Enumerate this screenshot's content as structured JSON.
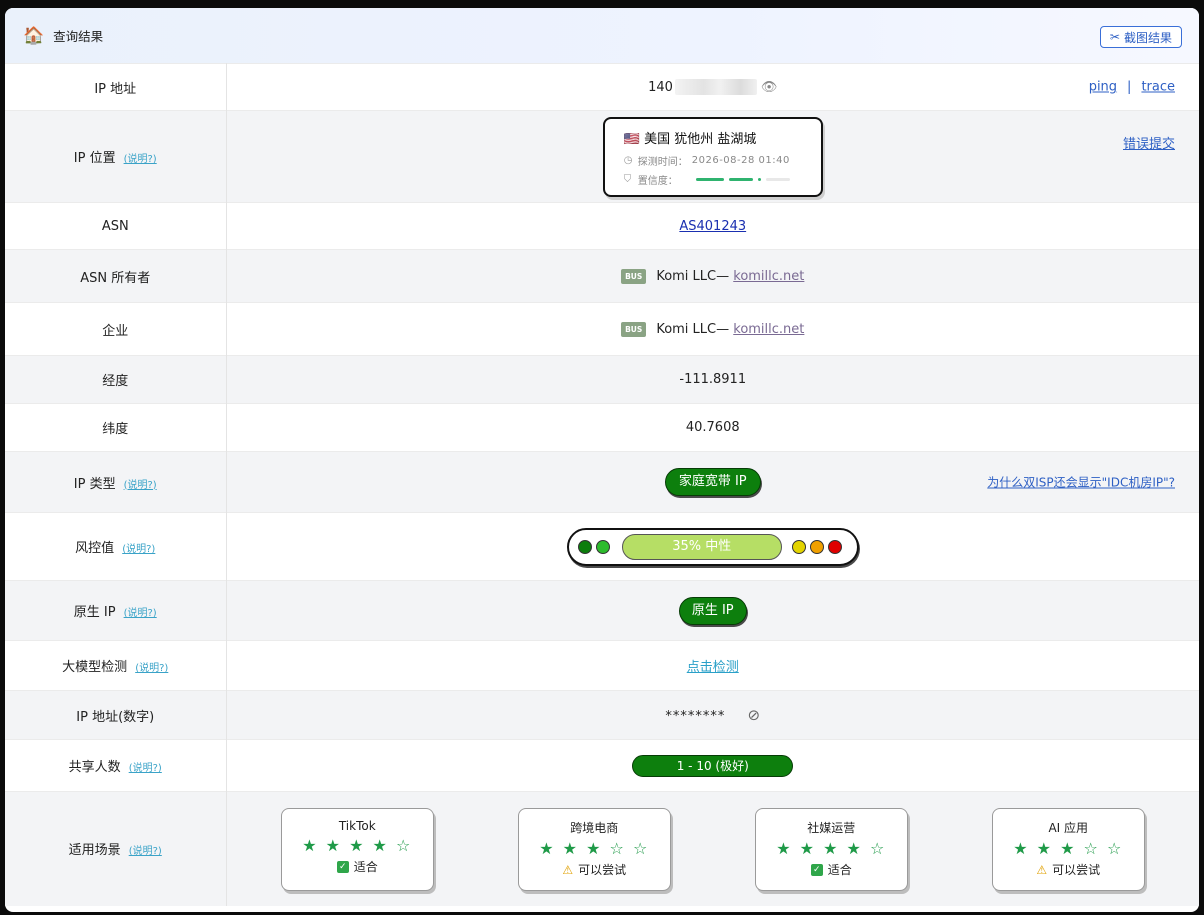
{
  "header": {
    "title": "查询结果",
    "screenshot_button": "截图结果"
  },
  "rows": {
    "ip": {
      "label": "IP 地址",
      "value_prefix": "140",
      "ping": "ping",
      "sep": "|",
      "trace": "trace"
    },
    "location": {
      "label": "IP 位置",
      "help": "(说明?)",
      "flag": "🇺🇸",
      "place": "美国 犹他州 盐湖城",
      "time_label": "探测时间：",
      "time_value": "2026-08-28 01:40",
      "confidence_label": "置信度：",
      "report": "错误提交"
    },
    "asn": {
      "label": "ASN",
      "value": "AS401243"
    },
    "asn_owner": {
      "label": "ASN 所有者",
      "badge": "BUS",
      "name": "Komi LLC— ",
      "domain": "komillc.net"
    },
    "company": {
      "label": "企业",
      "badge": "BUS",
      "name": "Komi LLC— ",
      "domain": "komillc.net"
    },
    "longitude": {
      "label": "经度",
      "value": "-111.8911"
    },
    "latitude": {
      "label": "纬度",
      "value": "40.7608"
    },
    "ip_type": {
      "label": "IP 类型",
      "help": "(说明?)",
      "value": "家庭宽带 IP",
      "why": "为什么双ISP还会显示\"IDC机房IP\"?"
    },
    "risk": {
      "label": "风控值",
      "help": "(说明?)",
      "value": "35%   中性",
      "percent": 35
    },
    "native": {
      "label": "原生 IP",
      "help": "(说明?)",
      "value": "原生 IP"
    },
    "llm": {
      "label": "大模型检测",
      "help": "(说明?)",
      "value": "点击检测"
    },
    "ip_number": {
      "label": "IP 地址(数字)",
      "value": "********"
    },
    "shared": {
      "label": "共享人数",
      "help": "(说明?)",
      "value": "1 - 10 (极好)"
    },
    "scenes": {
      "label": "适用场景",
      "help": "(说明?)",
      "items": [
        {
          "name": "TikTok",
          "stars": "★ ★ ★ ★ ☆",
          "verdict": "适合",
          "kind": "ok"
        },
        {
          "name": "跨境电商",
          "stars": "★ ★ ★ ☆ ☆",
          "verdict": "可以尝试",
          "kind": "warn"
        },
        {
          "name": "社媒运营",
          "stars": "★ ★ ★ ★ ☆",
          "verdict": "适合",
          "kind": "ok"
        },
        {
          "name": "AI 应用",
          "stars": "★ ★ ★ ☆ ☆",
          "verdict": "可以尝试",
          "kind": "warn"
        }
      ]
    }
  },
  "colors": {
    "green_pill": "#0d7f0d",
    "risk_meter": "#b6de65",
    "link_blue": "#2d5fc4",
    "help_cyan": "#3aa3c8",
    "star_green": "#1f9a48"
  }
}
